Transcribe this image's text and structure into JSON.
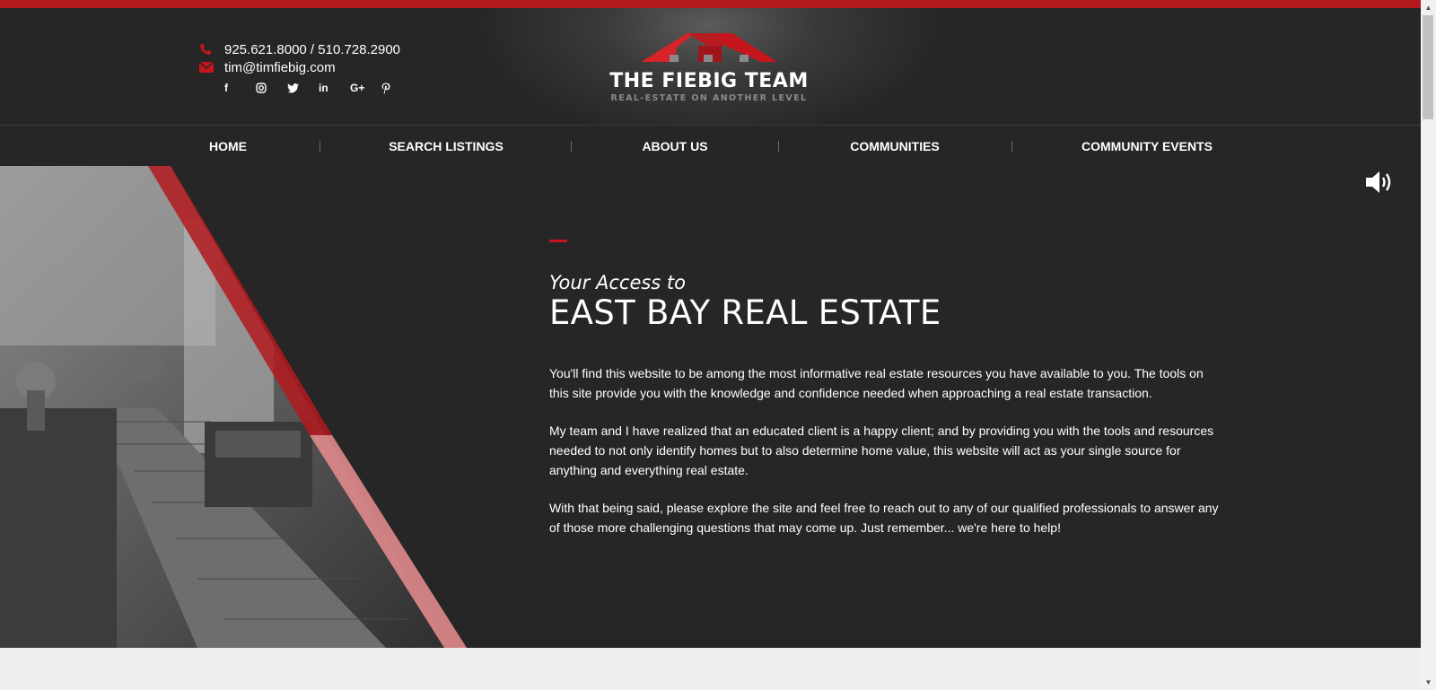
{
  "header": {
    "phone": "925.621.8000 / 510.728.2900",
    "email": "tim@timfiebig.com",
    "social": [
      {
        "name": "facebook-icon",
        "glyph": "f"
      },
      {
        "name": "instagram-icon",
        "glyph": "◎"
      },
      {
        "name": "twitter-icon",
        "glyph": "🐦"
      },
      {
        "name": "linkedin-icon",
        "glyph": "in"
      },
      {
        "name": "google-plus-icon",
        "glyph": "G+"
      },
      {
        "name": "pinterest-icon",
        "glyph": "P"
      }
    ],
    "logo_title": "THE FIEBIG TEAM",
    "logo_tagline": "REAL-ESTATE ON ANOTHER LEVEL"
  },
  "nav": {
    "items": [
      "HOME",
      "SEARCH LISTINGS",
      "ABOUT US",
      "COMMUNITIES",
      "COMMUNITY EVENTS"
    ]
  },
  "hero": {
    "pretitle": "Your Access to",
    "title": "EAST BAY REAL ESTATE",
    "paragraphs": [
      "You'll find this website to be among the most informative real estate resources you have available to you. The tools on this site provide you with the knowledge and confidence needed when approaching a real estate transaction.",
      "My team and I have realized that an educated client is a happy client; and by providing you with the tools and resources needed to not only identify homes but to also determine home value, this website will act as your single source for anything and everything real estate.",
      "With that being said, please explore the site and feel free to reach out to any of our qualified professionals to answer any of those more challenging questions that may come up. Just remember... we're here to help!"
    ]
  },
  "colors": {
    "accent": "#c4161c",
    "dark": "#262626",
    "topbar": "#b3191d"
  }
}
